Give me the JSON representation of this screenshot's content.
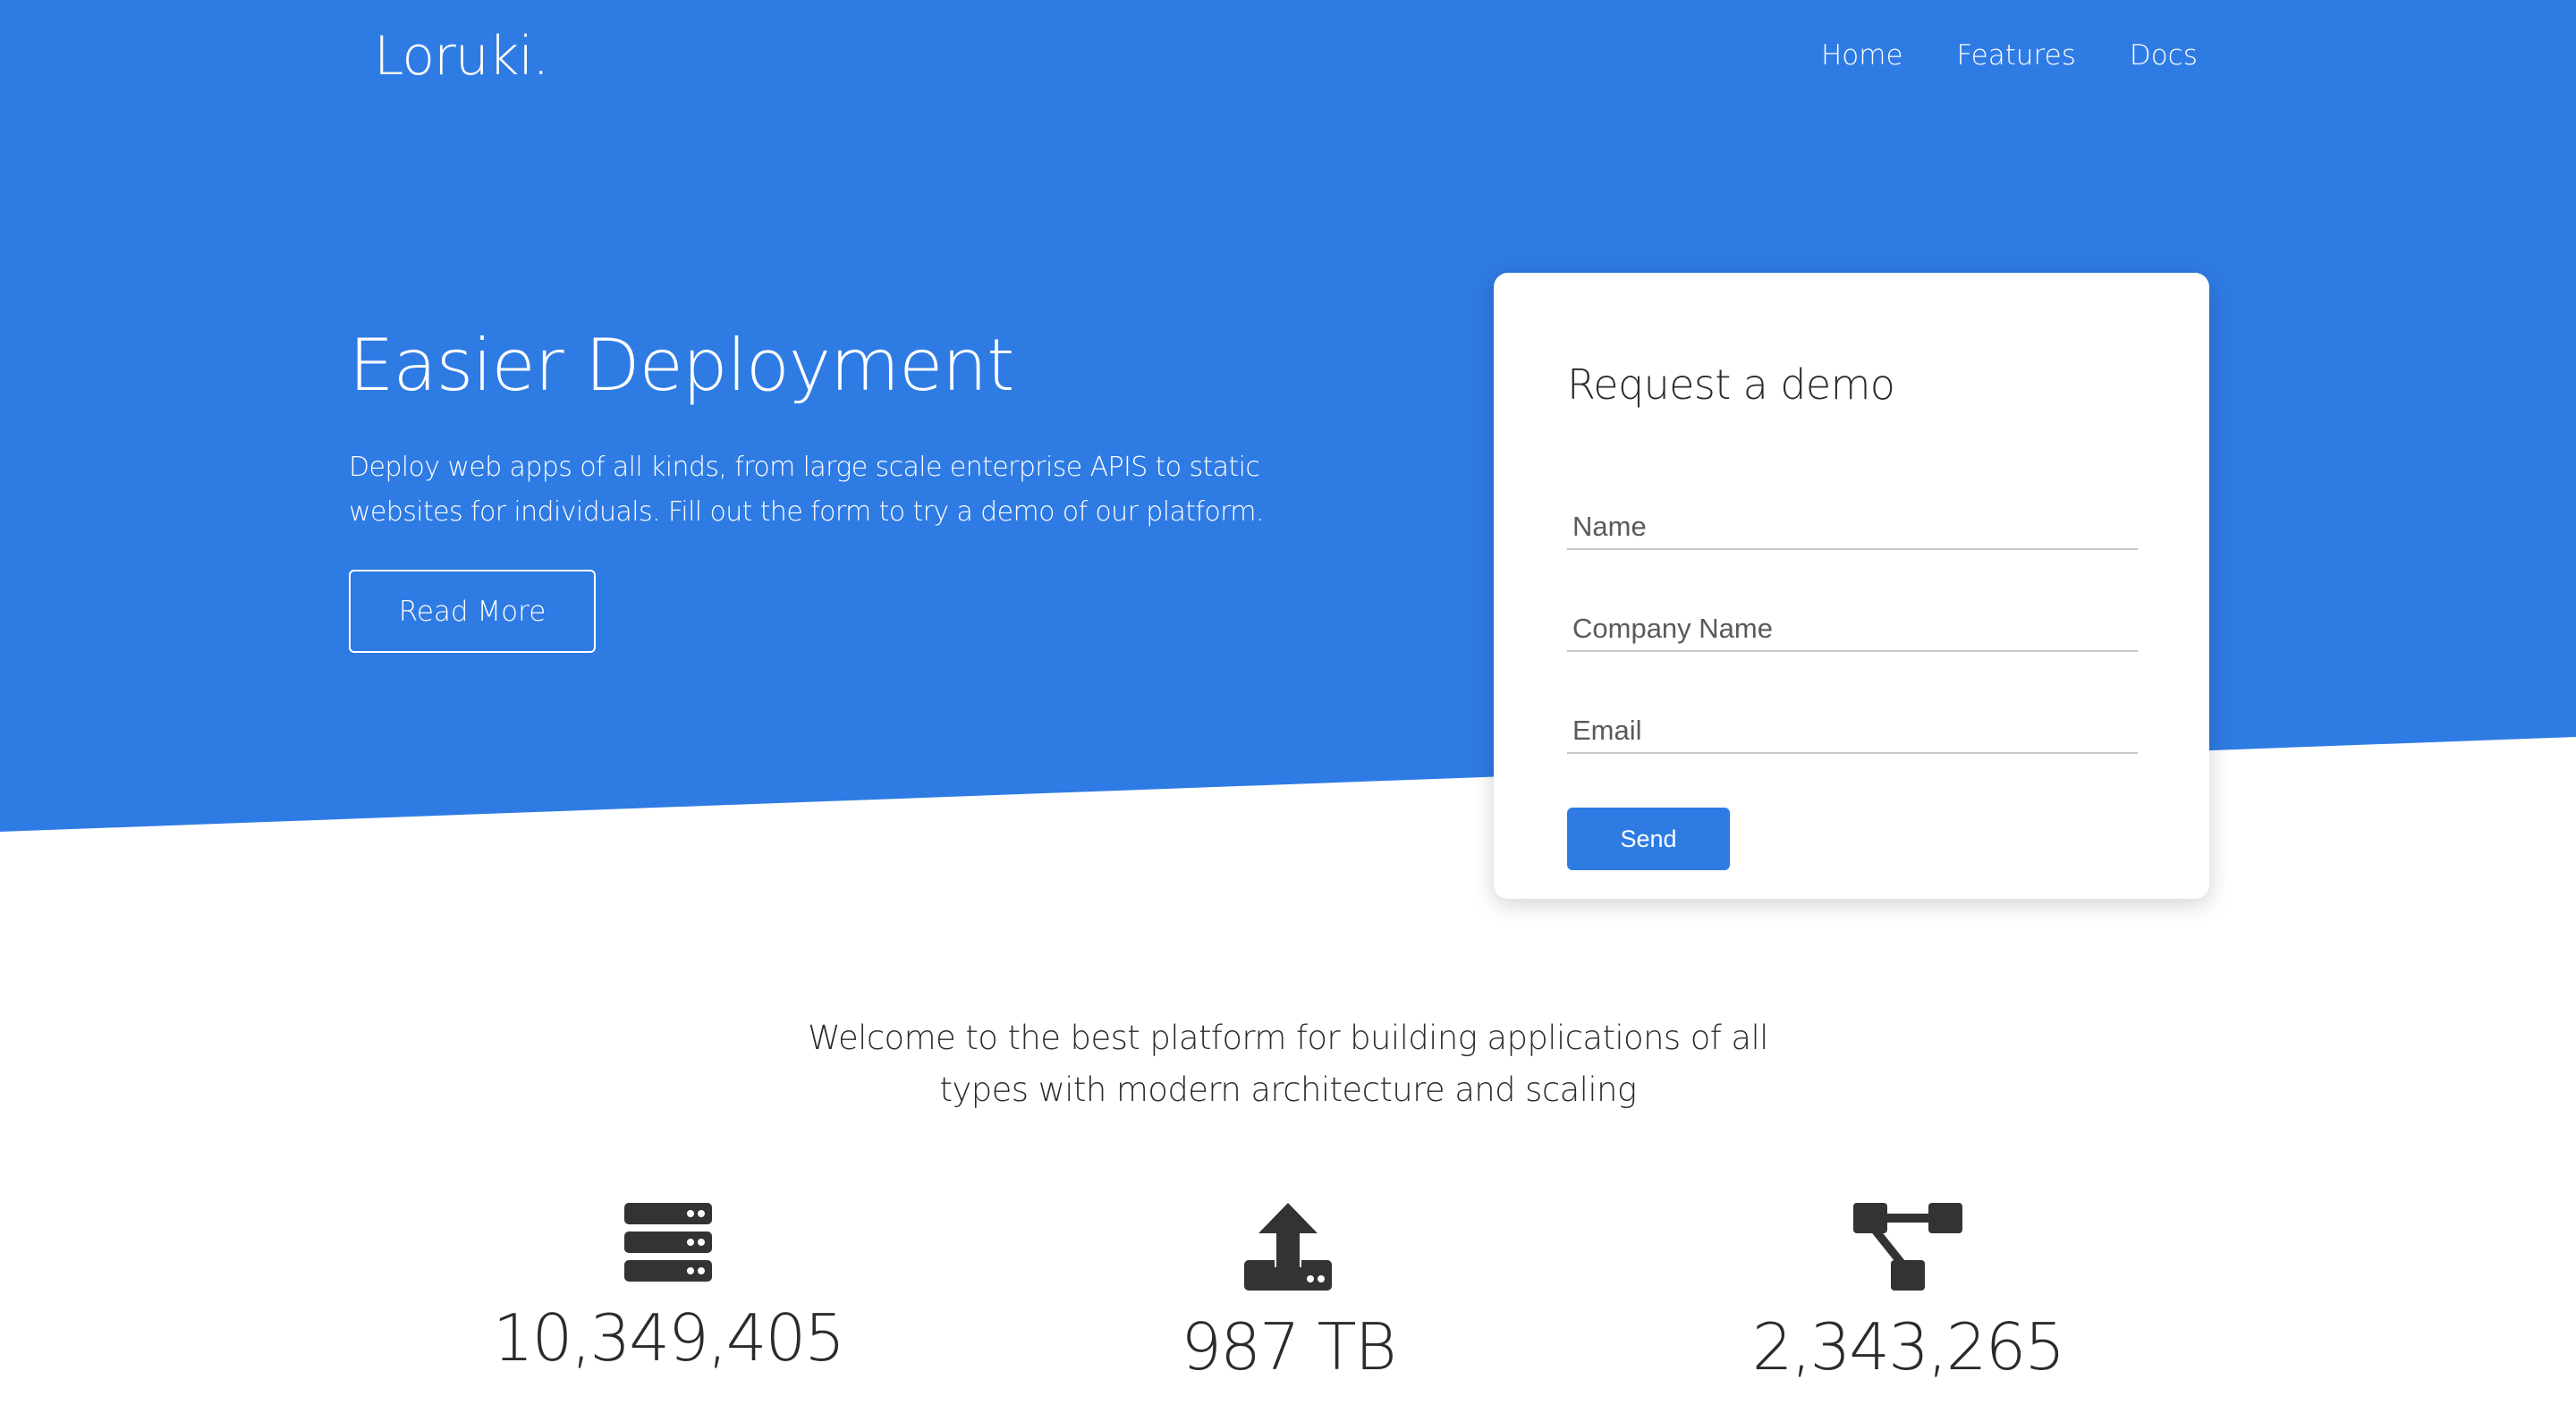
{
  "brand": {
    "name": "Loruki."
  },
  "nav": {
    "items": [
      "Home",
      "Features",
      "Docs"
    ]
  },
  "hero": {
    "title": "Easier Deployment",
    "text": "Deploy web apps of all kinds, from large scale enterprise APIS to static websites for individuals. Fill out the form to try a demo of our platform.",
    "read_more_label": "Read More"
  },
  "demo_form": {
    "title": "Request a demo",
    "name_placeholder": "Name",
    "company_placeholder": "Company Name",
    "email_placeholder": "Email",
    "send_label": "Send"
  },
  "welcome": {
    "line1": "Welcome to the best platform for building applications of all",
    "line2": "types with modern architecture and scaling"
  },
  "stats": [
    {
      "icon": "server-icon",
      "value": "10,349,405"
    },
    {
      "icon": "upload-icon",
      "value": "987 TB"
    },
    {
      "icon": "project-diagram-icon",
      "value": "2,343,265"
    }
  ],
  "colors": {
    "primary": "#2f7be4",
    "text": "#2b2b2b",
    "icon": "#333333"
  }
}
